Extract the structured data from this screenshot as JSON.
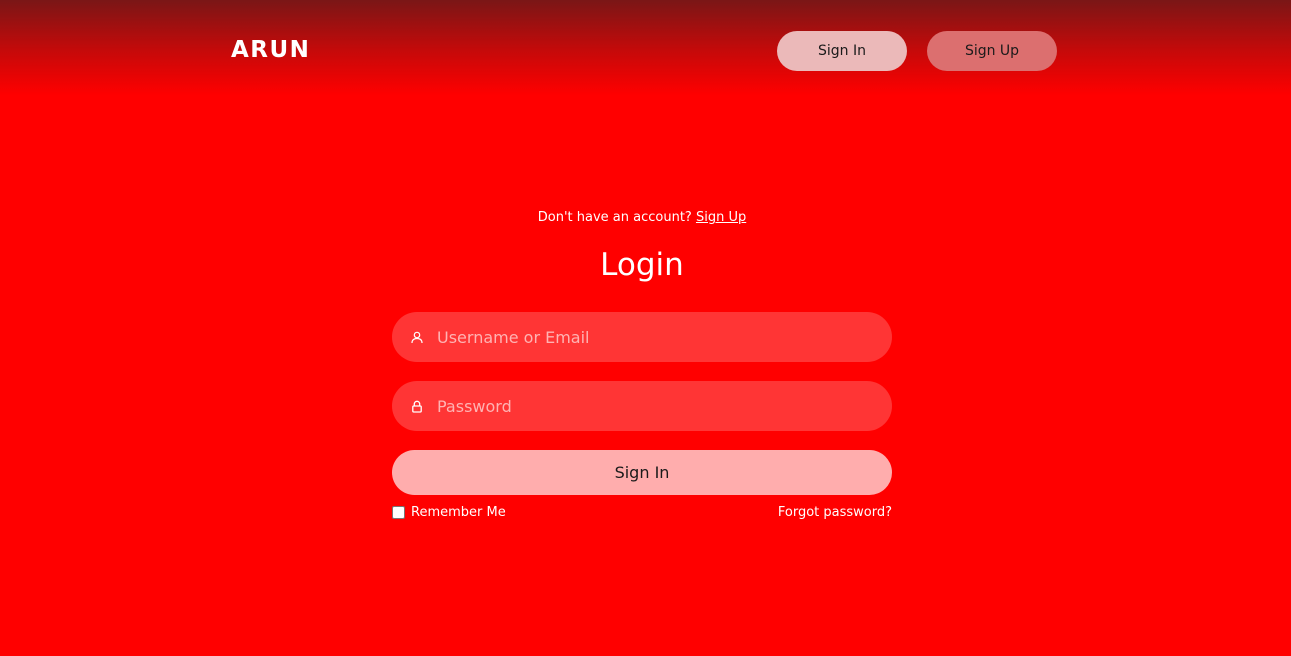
{
  "header": {
    "logo": "ARUN",
    "sign_in_label": "Sign In",
    "sign_up_label": "Sign Up"
  },
  "form": {
    "prompt_text": "Don't have an account?",
    "prompt_link": "Sign Up",
    "title": "Login",
    "username": {
      "placeholder": "Username or Email",
      "value": "",
      "icon": "user-icon"
    },
    "password": {
      "placeholder": "Password",
      "value": "",
      "icon": "lock-icon"
    },
    "submit_label": "Sign In",
    "remember_label": "Remember Me",
    "remember_checked": false,
    "forgot_label": "Forgot password?"
  },
  "colors": {
    "background": "#ff0000",
    "header_top": "#7a1616",
    "field_bg": "#ff3535",
    "submit_bg": "#ffadad",
    "nav_sign_in_bg": "#ebb9b9",
    "nav_sign_up_bg": "#dc6f6f"
  }
}
